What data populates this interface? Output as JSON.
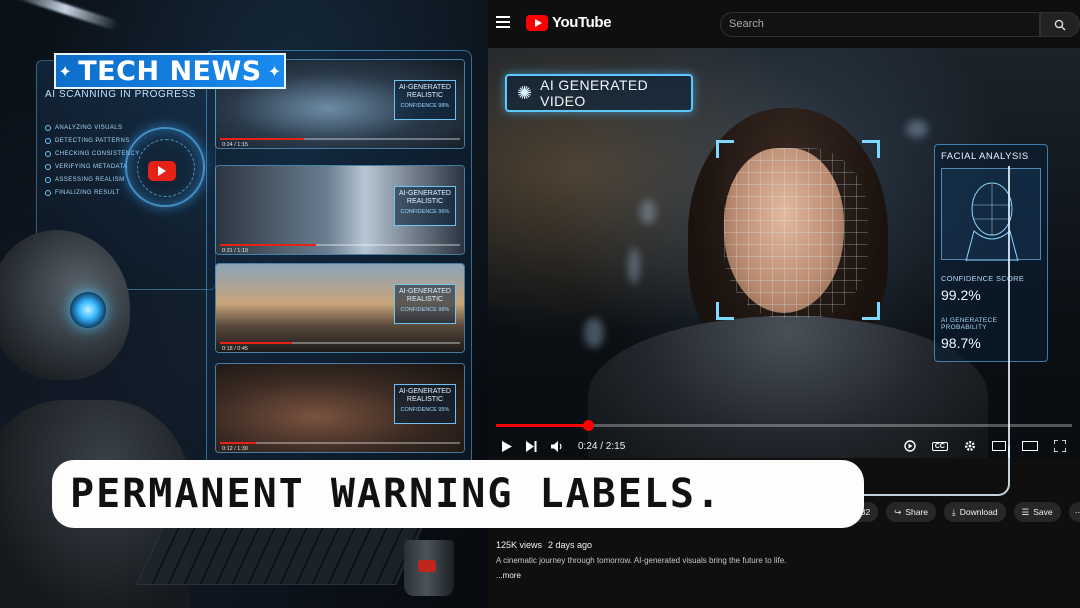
{
  "overlay": {
    "tech_news": "TECH NEWS",
    "headline": "PERMANENT WARNING LABELS."
  },
  "left_panel": {
    "title": "AI SCANNING IN PROGRESS",
    "scan_steps": [
      "ANALYZING VISUALS",
      "DETECTING PATTERNS",
      "CHECKING CONSISTENCY",
      "VERIFYING METADATA",
      "ASSESSING REALISM",
      "FINALIZING RESULT"
    ],
    "thumbnails": [
      {
        "tag_line1": "AI-GENERATED",
        "tag_line2": "REALISTIC",
        "confidence": "CONFIDENCE 98%",
        "time": "0:24 / 1:15",
        "progress": 0.35
      },
      {
        "tag_line1": "AI-GENERATED",
        "tag_line2": "REALISTIC",
        "confidence": "CONFIDENCE 96%",
        "time": "0:31 / 1:10",
        "progress": 0.4
      },
      {
        "tag_line1": "AI-GENERATED",
        "tag_line2": "REALISTIC",
        "confidence": "CONFIDENCE 98%",
        "time": "0:18 / 0:45",
        "progress": 0.3
      },
      {
        "tag_line1": "AI-GENERATED",
        "tag_line2": "REALISTIC",
        "confidence": "CONFIDENCE 95%",
        "time": "0:12 / 1:30",
        "progress": 0.15
      }
    ]
  },
  "youtube": {
    "logo_text": "YouTube",
    "search_placeholder": "Search",
    "ai_badge": "AI GENERATED VIDEO",
    "facial_panel": {
      "title": "FACIAL ANALYSIS",
      "confidence_label": "CONFIDENCE SCORE",
      "confidence_value": "99.2%",
      "probability_label": "AI GENERATECE PROBABILITY",
      "probability_value": "98.7%"
    },
    "player": {
      "time": "0:24 / 2:15",
      "progress": 0.16
    },
    "actions": {
      "like_count": "132",
      "share": "Share",
      "download": "Download",
      "save": "Save"
    },
    "description": {
      "views": "125K views",
      "age": "2 days ago",
      "text": "A cinematic journey through tomorrow. AI-generated visuals bring the future to life.",
      "more": "...more"
    }
  },
  "colors": {
    "yt_red": "#ff0000",
    "holo_blue": "#5cc8ff",
    "tech_news_blue": "#1a8af0"
  }
}
